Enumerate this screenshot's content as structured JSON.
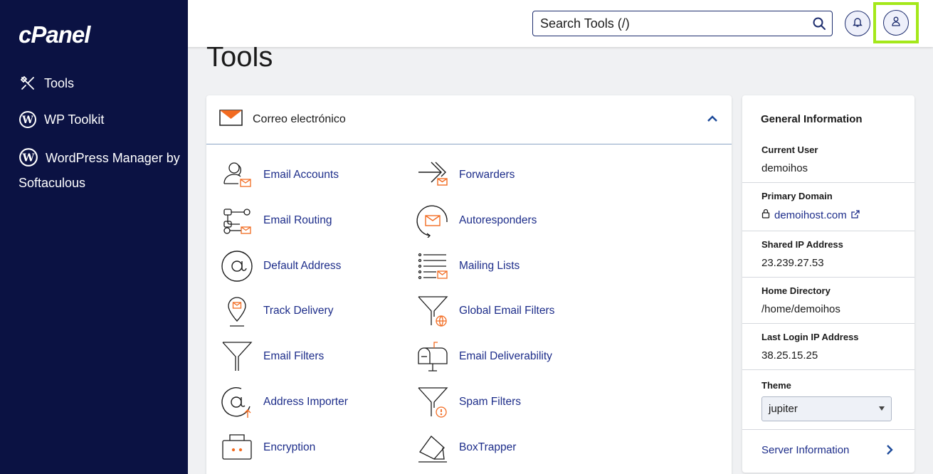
{
  "app": {
    "logo": "cPanel"
  },
  "sidebar": {
    "items": [
      {
        "label": "Tools",
        "icon": "tools-icon"
      },
      {
        "label": "WP Toolkit",
        "icon": "wordpress-icon"
      },
      {
        "label": "WordPress Manager by Softaculous",
        "icon": "wordpress-icon"
      }
    ]
  },
  "header": {
    "search_placeholder": "Search Tools (/)",
    "icons": [
      "search-icon",
      "bell-icon",
      "user-icon"
    ],
    "highlight_color": "#a4e81a"
  },
  "page": {
    "title": "Tools"
  },
  "email_section": {
    "title": "Correo electrónico",
    "icon": "envelope-icon",
    "accent_color": "#f26b21",
    "tools_left": [
      {
        "label": "Email Accounts",
        "icon": "email-accounts-icon"
      },
      {
        "label": "Email Routing",
        "icon": "email-routing-icon"
      },
      {
        "label": "Default Address",
        "icon": "at-sign-icon"
      },
      {
        "label": "Track Delivery",
        "icon": "location-pin-icon"
      },
      {
        "label": "Email Filters",
        "icon": "funnel-icon"
      },
      {
        "label": "Address Importer",
        "icon": "at-upload-icon"
      },
      {
        "label": "Encryption",
        "icon": "lock-box-icon"
      }
    ],
    "tools_right": [
      {
        "label": "Forwarders",
        "icon": "forward-arrow-icon"
      },
      {
        "label": "Autoresponders",
        "icon": "autoresponder-icon"
      },
      {
        "label": "Mailing Lists",
        "icon": "mailing-list-icon"
      },
      {
        "label": "Global Email Filters",
        "icon": "global-filter-icon"
      },
      {
        "label": "Email Deliverability",
        "icon": "mailbox-icon"
      },
      {
        "label": "Spam Filters",
        "icon": "spam-filter-icon"
      },
      {
        "label": "BoxTrapper",
        "icon": "box-trap-icon"
      }
    ]
  },
  "general_info": {
    "title": "General Information",
    "current_user_label": "Current User",
    "current_user": "demoihos",
    "primary_domain_label": "Primary Domain",
    "primary_domain": "demoihost.com",
    "shared_ip_label": "Shared IP Address",
    "shared_ip": "23.239.27.53",
    "home_dir_label": "Home Directory",
    "home_dir": "/home/demoihos",
    "last_login_label": "Last Login IP Address",
    "last_login_ip": "38.25.15.25",
    "theme_label": "Theme",
    "theme_value": "jupiter",
    "server_info_label": "Server Information"
  }
}
